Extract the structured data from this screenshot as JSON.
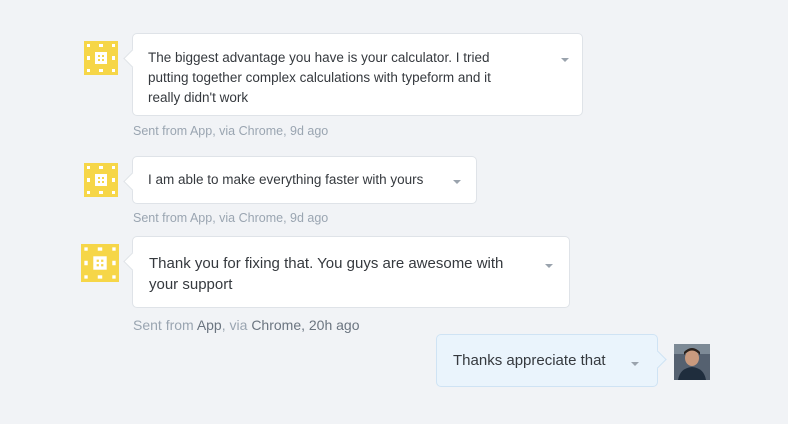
{
  "conversation": {
    "messages": [
      {
        "text_lines": [
          "The biggest advantage you have is your calculator. I tried",
          "putting together complex calculations with typeform and it",
          "really didn't work"
        ],
        "meta": "Sent from App, via Chrome, 9d ago"
      },
      {
        "text_lines": [
          "I am able to make everything faster with yours"
        ],
        "meta": "Sent from App, via Chrome, 9d ago"
      },
      {
        "text_lines": [
          "Thank you for fixing that. You guys are awesome with",
          "your support"
        ],
        "meta_parts": [
          "Sent from ",
          "App",
          ", via ",
          "Chrome",
          ", 20h ago"
        ]
      }
    ],
    "reply": {
      "text": "Thanks appreciate that"
    }
  },
  "icons": {
    "user_avatar": "identicon-avatar",
    "admin_avatar": "user-photo-avatar",
    "menu": "chevron-down-icon"
  },
  "colors": {
    "background": "#f1f3f6",
    "identicon": "#f6d648",
    "admin_bubble": "#eaf4fc"
  }
}
